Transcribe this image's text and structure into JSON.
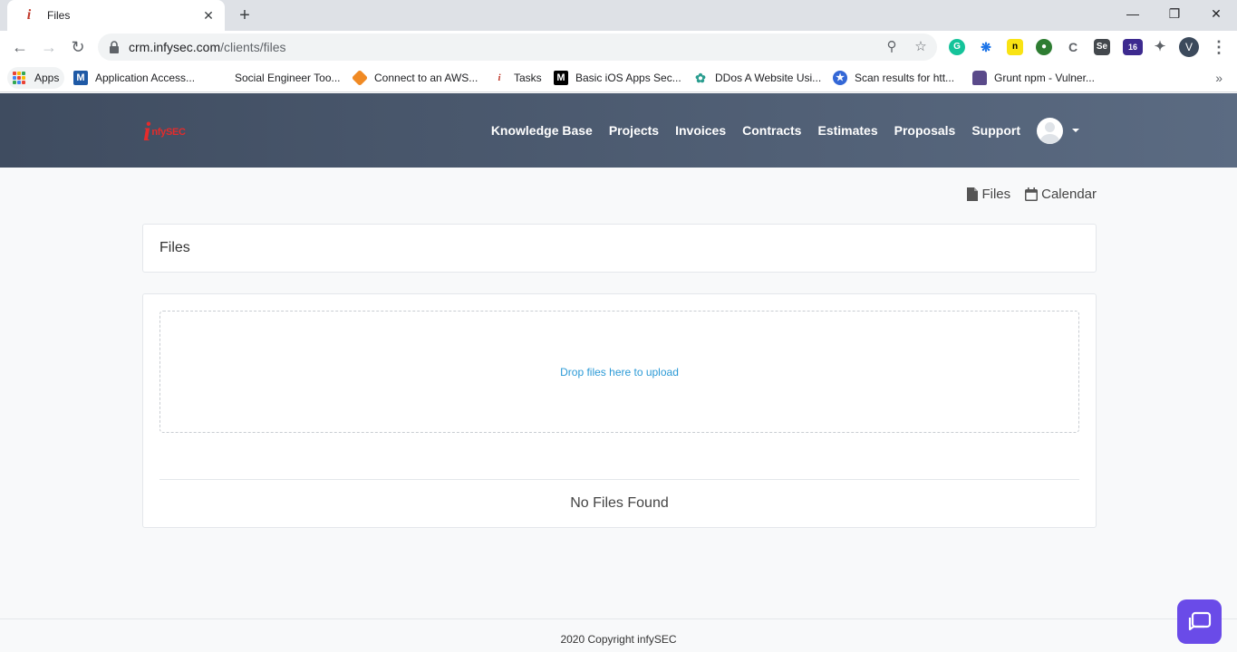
{
  "browser": {
    "tab": {
      "title": "Files",
      "favicon": "i"
    },
    "url": {
      "host": "crm.infysec.com",
      "path": "/clients/files"
    },
    "profile_initial": "V",
    "extensions": {
      "ext5_label": "Se",
      "ext6_badge": "16"
    },
    "bookmarks": [
      {
        "label": "Apps"
      },
      {
        "label": "Application Access..."
      },
      {
        "label": "Social Engineer Too..."
      },
      {
        "label": "Connect to an AWS..."
      },
      {
        "label": "Tasks"
      },
      {
        "label": "Basic iOS Apps Sec..."
      },
      {
        "label": "DDos A Website Usi..."
      },
      {
        "label": "Scan results for htt..."
      },
      {
        "label": "Grunt npm - Vulner..."
      }
    ]
  },
  "site": {
    "logo": {
      "letter": "i",
      "text": "nfySEC"
    },
    "nav": [
      "Knowledge Base",
      "Projects",
      "Invoices",
      "Contracts",
      "Estimates",
      "Proposals",
      "Support"
    ]
  },
  "actions": {
    "files": "Files",
    "calendar": "Calendar"
  },
  "panel": {
    "title": "Files"
  },
  "dropzone": {
    "text": "Drop files here to upload"
  },
  "empty_state": "No Files Found",
  "footer": {
    "text": "2020 Copyright infySEC"
  },
  "colors": {
    "header_start": "#3f4c60",
    "header_end": "#5b6b82",
    "link": "#2c9ad6",
    "chat": "#6a4be8",
    "logo_red": "#e52b2b"
  }
}
